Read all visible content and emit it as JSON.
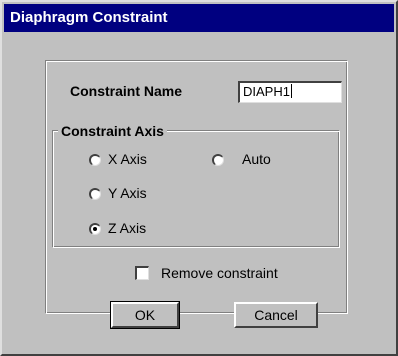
{
  "window": {
    "title": "Diaphragm Constraint"
  },
  "constraint_name": {
    "label": "Constraint Name",
    "value": "DIAPH1"
  },
  "constraint_axis": {
    "legend": "Constraint Axis",
    "options": [
      {
        "label": "X Axis",
        "selected": false
      },
      {
        "label": "Auto",
        "selected": false
      },
      {
        "label": "Y Axis",
        "selected": false
      },
      {
        "label": "Z Axis",
        "selected": true
      }
    ]
  },
  "remove_constraint": {
    "label": "Remove constraint",
    "checked": false
  },
  "buttons": {
    "ok": "OK",
    "cancel": "Cancel"
  }
}
